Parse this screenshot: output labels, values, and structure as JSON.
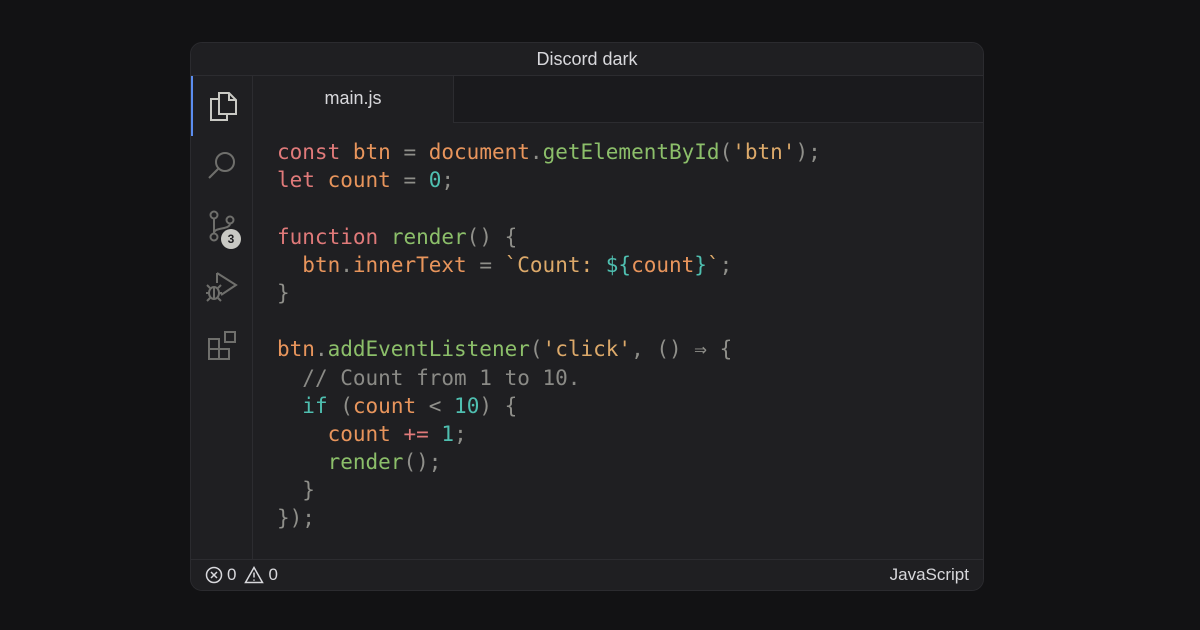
{
  "window": {
    "title": "Discord dark"
  },
  "tabs": [
    {
      "label": "main.js"
    }
  ],
  "activity_bar": {
    "items": [
      {
        "icon": "files-icon",
        "active": true
      },
      {
        "icon": "search-icon"
      },
      {
        "icon": "source-control-icon",
        "badge": "3"
      },
      {
        "icon": "run-debug-icon"
      },
      {
        "icon": "extensions-icon"
      }
    ]
  },
  "editor": {
    "lines": [
      [
        {
          "t": "const",
          "c": "kw"
        },
        {
          "t": " ",
          "c": "pu"
        },
        {
          "t": "btn",
          "c": "id"
        },
        {
          "t": " = ",
          "c": "op"
        },
        {
          "t": "document",
          "c": "id"
        },
        {
          "t": ".",
          "c": "pu"
        },
        {
          "t": "getElementById",
          "c": "fn"
        },
        {
          "t": "(",
          "c": "pu"
        },
        {
          "t": "'btn'",
          "c": "str"
        },
        {
          "t": ");",
          "c": "pu"
        }
      ],
      [
        {
          "t": "let",
          "c": "kw"
        },
        {
          "t": " ",
          "c": "pu"
        },
        {
          "t": "count",
          "c": "id"
        },
        {
          "t": " = ",
          "c": "op"
        },
        {
          "t": "0",
          "c": "num"
        },
        {
          "t": ";",
          "c": "pu"
        }
      ],
      [],
      [
        {
          "t": "function",
          "c": "kw"
        },
        {
          "t": " ",
          "c": "pu"
        },
        {
          "t": "render",
          "c": "fn"
        },
        {
          "t": "() {",
          "c": "pu"
        }
      ],
      [
        {
          "t": "  ",
          "c": "pu"
        },
        {
          "t": "btn",
          "c": "id"
        },
        {
          "t": ".",
          "c": "pu"
        },
        {
          "t": "innerText",
          "c": "id"
        },
        {
          "t": " = ",
          "c": "op"
        },
        {
          "t": "`Count: ",
          "c": "str"
        },
        {
          "t": "${",
          "c": "num"
        },
        {
          "t": "count",
          "c": "id"
        },
        {
          "t": "}",
          "c": "num"
        },
        {
          "t": "`",
          "c": "str"
        },
        {
          "t": ";",
          "c": "pu"
        }
      ],
      [
        {
          "t": "}",
          "c": "pu"
        }
      ],
      [],
      [
        {
          "t": "btn",
          "c": "id"
        },
        {
          "t": ".",
          "c": "pu"
        },
        {
          "t": "addEventListener",
          "c": "fn"
        },
        {
          "t": "(",
          "c": "pu"
        },
        {
          "t": "'click'",
          "c": "str"
        },
        {
          "t": ", () ⇒ {",
          "c": "pu"
        }
      ],
      [
        {
          "t": "  ",
          "c": "pu"
        },
        {
          "t": "// Count from 1 to 10.",
          "c": "cm"
        }
      ],
      [
        {
          "t": "  ",
          "c": "pu"
        },
        {
          "t": "if",
          "c": "kw2"
        },
        {
          "t": " (",
          "c": "pu"
        },
        {
          "t": "count",
          "c": "id"
        },
        {
          "t": " < ",
          "c": "op"
        },
        {
          "t": "10",
          "c": "num"
        },
        {
          "t": ") {",
          "c": "pu"
        }
      ],
      [
        {
          "t": "    ",
          "c": "pu"
        },
        {
          "t": "count",
          "c": "id"
        },
        {
          "t": " ",
          "c": "pu"
        },
        {
          "t": "+=",
          "c": "kw"
        },
        {
          "t": " ",
          "c": "pu"
        },
        {
          "t": "1",
          "c": "num"
        },
        {
          "t": ";",
          "c": "pu"
        }
      ],
      [
        {
          "t": "    ",
          "c": "pu"
        },
        {
          "t": "render",
          "c": "fn"
        },
        {
          "t": "();",
          "c": "pu"
        }
      ],
      [
        {
          "t": "  }",
          "c": "pu"
        }
      ],
      [
        {
          "t": "});",
          "c": "pu"
        }
      ]
    ]
  },
  "status_bar": {
    "errors": "0",
    "warnings": "0",
    "language": "JavaScript"
  },
  "colors": {
    "accent": "#5b8def",
    "keyword": "#e07a7a",
    "identifier": "#e8955c",
    "function": "#8cbf6a",
    "string": "#dca96a",
    "number": "#4fbfb0",
    "comment": "#8a8a86"
  }
}
